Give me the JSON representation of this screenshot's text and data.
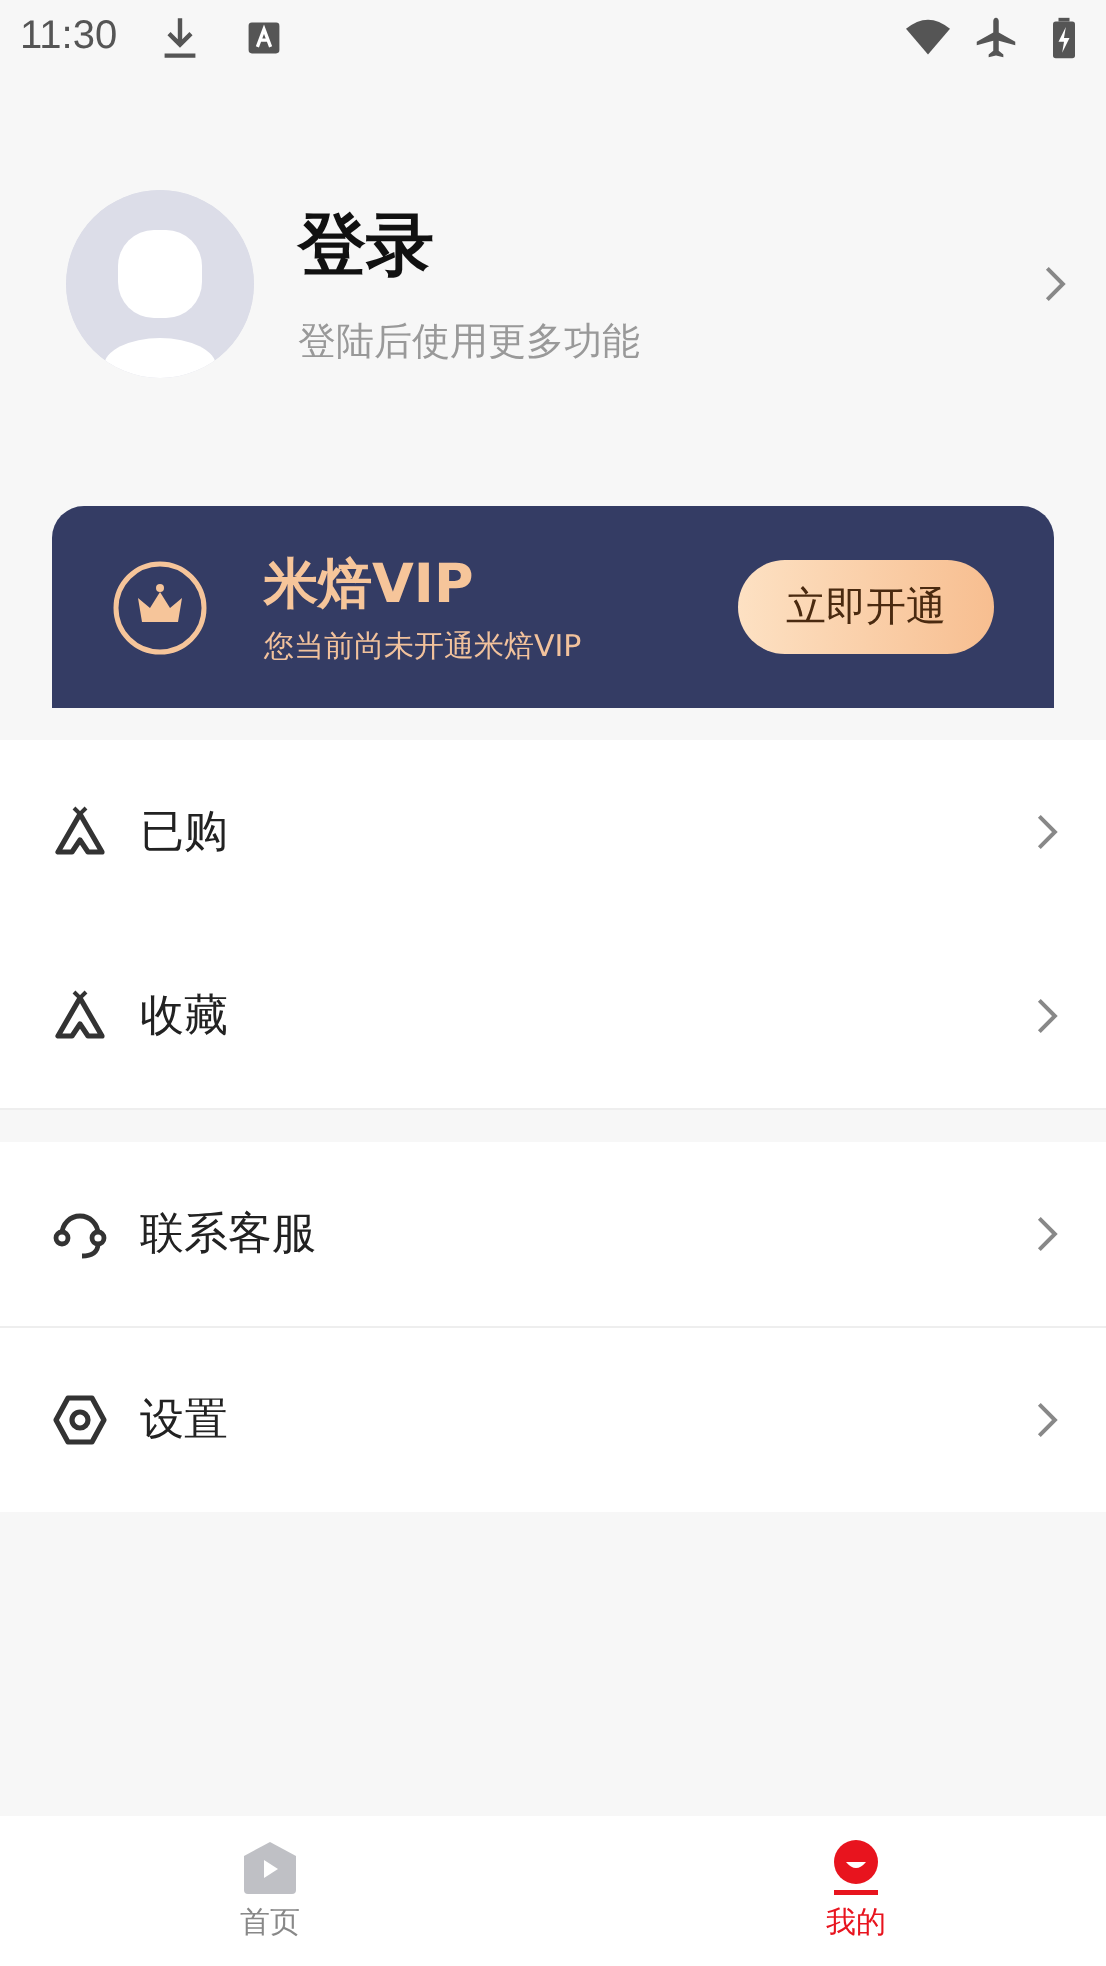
{
  "status_bar": {
    "time": "11:30"
  },
  "profile": {
    "name": "登录",
    "subtitle": "登陆后使用更多功能"
  },
  "vip": {
    "title": "米焙VIP",
    "subtitle": "您当前尚未开通米焙VIP",
    "button": "立即开通"
  },
  "menu_groups": [
    {
      "items": [
        {
          "kind": "tent",
          "label": "已购"
        },
        {
          "kind": "tent",
          "label": "收藏"
        }
      ]
    },
    {
      "items": [
        {
          "kind": "headset",
          "label": "联系客服"
        },
        {
          "kind": "hexagon",
          "label": "设置"
        }
      ]
    }
  ],
  "tab_bar": [
    {
      "kind": "home",
      "label": "首页",
      "selected": false
    },
    {
      "kind": "me",
      "label": "我的",
      "selected": true
    }
  ]
}
